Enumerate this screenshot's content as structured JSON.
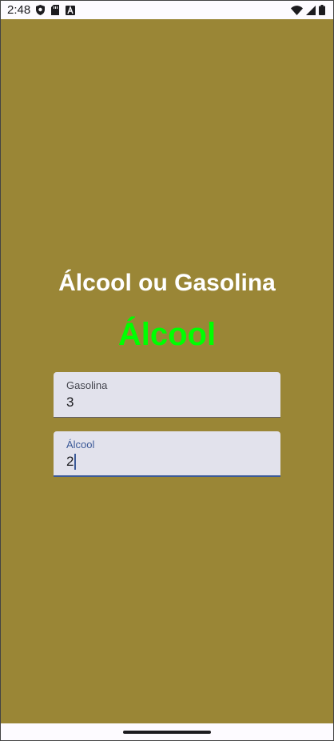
{
  "status_bar": {
    "time": "2:48",
    "left_icons": [
      "shield-icon",
      "sd-card-icon",
      "keyboard-a-icon"
    ],
    "right_icons": [
      "wifi-icon",
      "signal-icon",
      "battery-icon"
    ]
  },
  "app": {
    "title": "Álcool ou Gasolina",
    "result": "Álcool",
    "background_color": "#9a8636",
    "result_color": "#00ff00"
  },
  "fields": {
    "gasolina": {
      "label": "Gasolina",
      "value": "3"
    },
    "alcool": {
      "label": "Álcool",
      "value": "2"
    }
  }
}
